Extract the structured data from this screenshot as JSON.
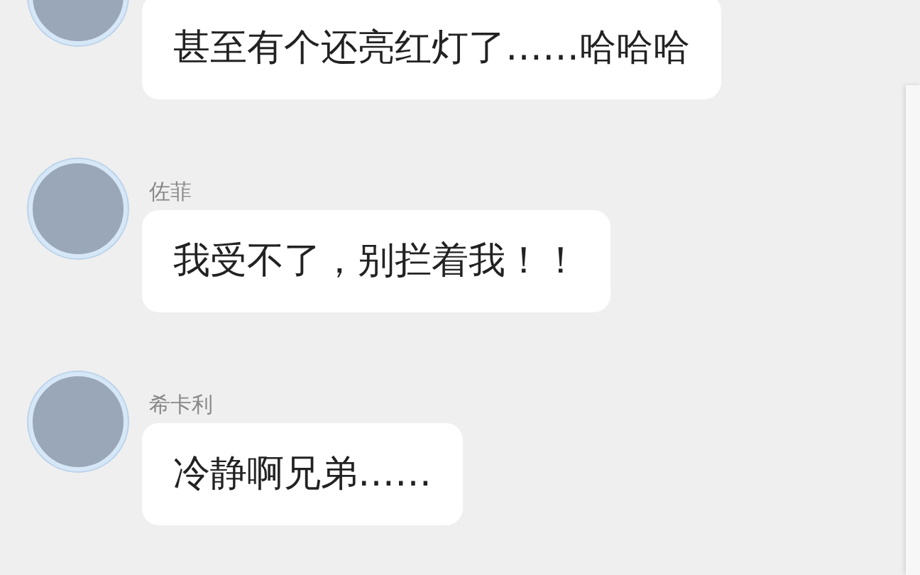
{
  "messages": [
    {
      "text": "甚至有个还亮红灯了……哈哈哈"
    },
    {
      "name": "佐菲",
      "text": "我受不了，别拦着我！！"
    },
    {
      "name": "希卡利",
      "text": "冷静啊兄弟……"
    }
  ]
}
